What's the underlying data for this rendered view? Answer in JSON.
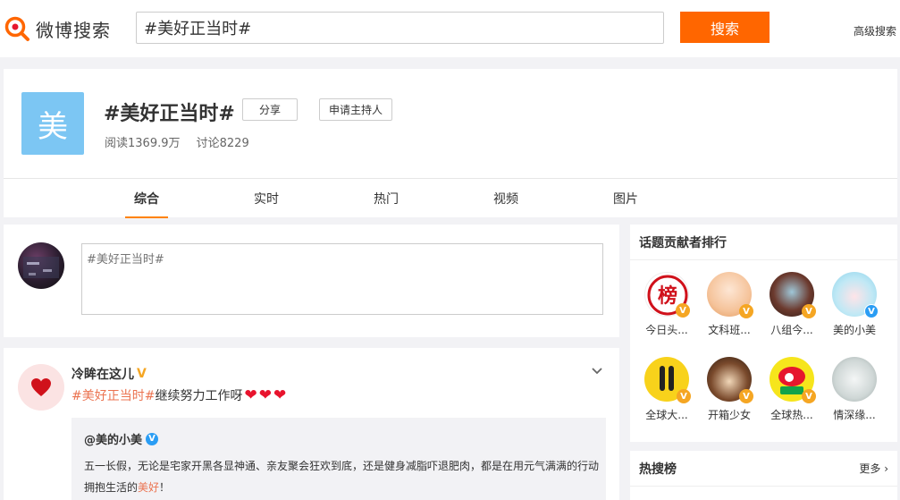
{
  "header": {
    "logo_text": "微博搜索",
    "search_value": "#美好正当时#",
    "search_button": "搜索",
    "advanced_link": "高级搜索"
  },
  "topic": {
    "icon_char": "美",
    "title": "#美好正当时#",
    "share_button": "分享",
    "host_button": "申请主持人",
    "reads": "阅读1369.9万",
    "discussions": "讨论8229",
    "tabs": [
      "综合",
      "实时",
      "热门",
      "视频",
      "图片"
    ],
    "active_tab": "综合"
  },
  "composer": {
    "placeholder": "#美好正当时#"
  },
  "feed": {
    "user": "冷眸在这儿",
    "user_badge": "V",
    "hashtag": "#美好正当时#",
    "text": " 继续努力工作呀",
    "repost": {
      "user": "@美的小美",
      "user_badge": "V",
      "text_before": "五一长假，无论是宅家开黑各显神通、亲友聚会狂欢到底，还是健身减脂吓退肥肉，都是在用元气满满的行动拥抱生活的",
      "text_highlight": "美好",
      "text_after": "！"
    }
  },
  "sidebar": {
    "contributors_title": "话题贡献者排行",
    "contributors": [
      {
        "name": "今日头...",
        "badge": "V"
      },
      {
        "name": "文科班...",
        "badge": "V"
      },
      {
        "name": "八组今...",
        "badge": "V"
      },
      {
        "name": "美的小美",
        "badge": "V"
      },
      {
        "name": "全球大...",
        "badge": "V"
      },
      {
        "name": "开箱少女",
        "badge": "V"
      },
      {
        "name": "全球热...",
        "badge": "V"
      },
      {
        "name": "情深缘...",
        "badge": ""
      }
    ],
    "hot_title": "热搜榜",
    "hot_more": "更多"
  },
  "colors": {
    "accent_orange": "#ff6600",
    "tab_underline": "#ff8200",
    "hashtag": "#eb7350",
    "topic_icon_bg": "#7cc6f3",
    "gold_badge": "#f5a623",
    "blue_badge": "#2a9df4"
  }
}
